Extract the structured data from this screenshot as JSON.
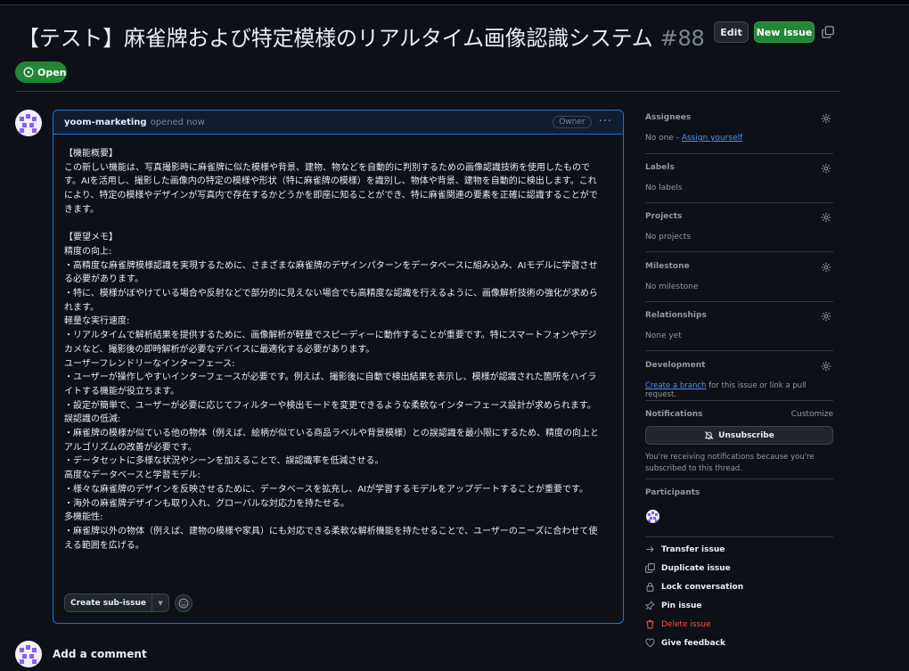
{
  "header": {
    "title": "【テスト】麻雀牌および特定模様のリアルタイム画像認識システム",
    "number": "#88",
    "edit_label": "Edit",
    "new_issue_label": "New issue",
    "state": "Open"
  },
  "comment": {
    "author": "yoom-marketing",
    "meta": "opened now",
    "role": "Owner",
    "menu": "···",
    "paragraphs_1": [
      "【機能概要】",
      "この新しい機能は、写真撮影時に麻雀牌に似た模様や背景、建物、物などを自動的に判別するための画像認識技術を使用したものです。AIを活用し、撮影した画像内の特定の模様や形状（特に麻雀牌の模様）を識別し、物体や背景、建物を自動的に検出します。これにより、特定の模様やデザインが写真内で存在するかどうかを即座に知ることができ、特に麻雀関連の要素を正確に認識することができます。"
    ],
    "paragraphs_2": [
      "【要望メモ】",
      "精度の向上:",
      "・高精度な麻雀牌模様認識を実現するために、さまざまな麻雀牌のデザインパターンをデータベースに組み込み、AIモデルに学習させる必要があります。",
      "・特に、模様がぼやけている場合や反射などで部分的に見えない場合でも高精度な認識を行えるように、画像解析技術の強化が求められます。",
      "軽量な実行速度:",
      "・リアルタイムで解析結果を提供するために、画像解析が軽量でスピーディーに動作することが重要です。特にスマートフォンやデジカメなど、撮影後の即時解析が必要なデバイスに最適化する必要があります。",
      "ユーザーフレンドリーなインターフェース:",
      "・ユーザーが操作しやすいインターフェースが必要です。例えば、撮影後に自動で検出結果を表示し、模様が認識された箇所をハイライトする機能が役立ちます。",
      "・設定が簡単で、ユーザーが必要に応じてフィルターや検出モードを変更できるような柔軟なインターフェース設計が求められます。",
      "誤認識の低減:",
      "・麻雀牌の模様が似ている他の物体（例えば、絵柄が似ている商品ラベルや背景模様）との誤認識を最小限にするため、精度の向上とアルゴリズムの改善が必要です。",
      "・データセットに多様な状況やシーンを加えることで、誤認識率を低減させる。",
      "高度なデータベースと学習モデル:",
      "・様々な麻雀牌のデザインを反映させるために、データベースを拡充し、AIが学習するモデルをアップデートすることが重要です。",
      "・海外の麻雀牌デザインも取り入れ、グローバルな対応力を持たせる。",
      "多機能性:",
      "・麻雀牌以外の物体（例えば、建物の模様や家具）にも対応できる柔軟な解析機能を持たせることで、ユーザーのニーズに合わせて使える範囲を広げる。"
    ],
    "sub_issue_label": "Create sub-issue"
  },
  "add_comment": "Add a comment",
  "sidebar": {
    "assignees": {
      "heading": "Assignees",
      "value": "No one - ",
      "link": "Assign yourself"
    },
    "labels": {
      "heading": "Labels",
      "value": "No labels"
    },
    "projects": {
      "heading": "Projects",
      "value": "No projects"
    },
    "milestone": {
      "heading": "Milestone",
      "value": "No milestone"
    },
    "relationships": {
      "heading": "Relationships",
      "value": "None yet"
    },
    "development": {
      "heading": "Development",
      "link": "Create a branch",
      "value": " for this issue or link a pull request."
    },
    "notifications": {
      "heading": "Notifications",
      "customize": "Customize",
      "unsubscribe": "Unsubscribe",
      "note": "You're receiving notifications because you're subscribed to this thread."
    },
    "participants": {
      "heading": "Participants"
    },
    "actions": {
      "transfer": "Transfer issue",
      "duplicate": "Duplicate issue",
      "lock": "Lock conversation",
      "pin": "Pin issue",
      "delete": "Delete issue",
      "feedback": "Give feedback"
    }
  },
  "colors": {
    "accent": "#238636",
    "link": "#4493f8",
    "danger": "#f85149",
    "bg": "#0d1117"
  }
}
